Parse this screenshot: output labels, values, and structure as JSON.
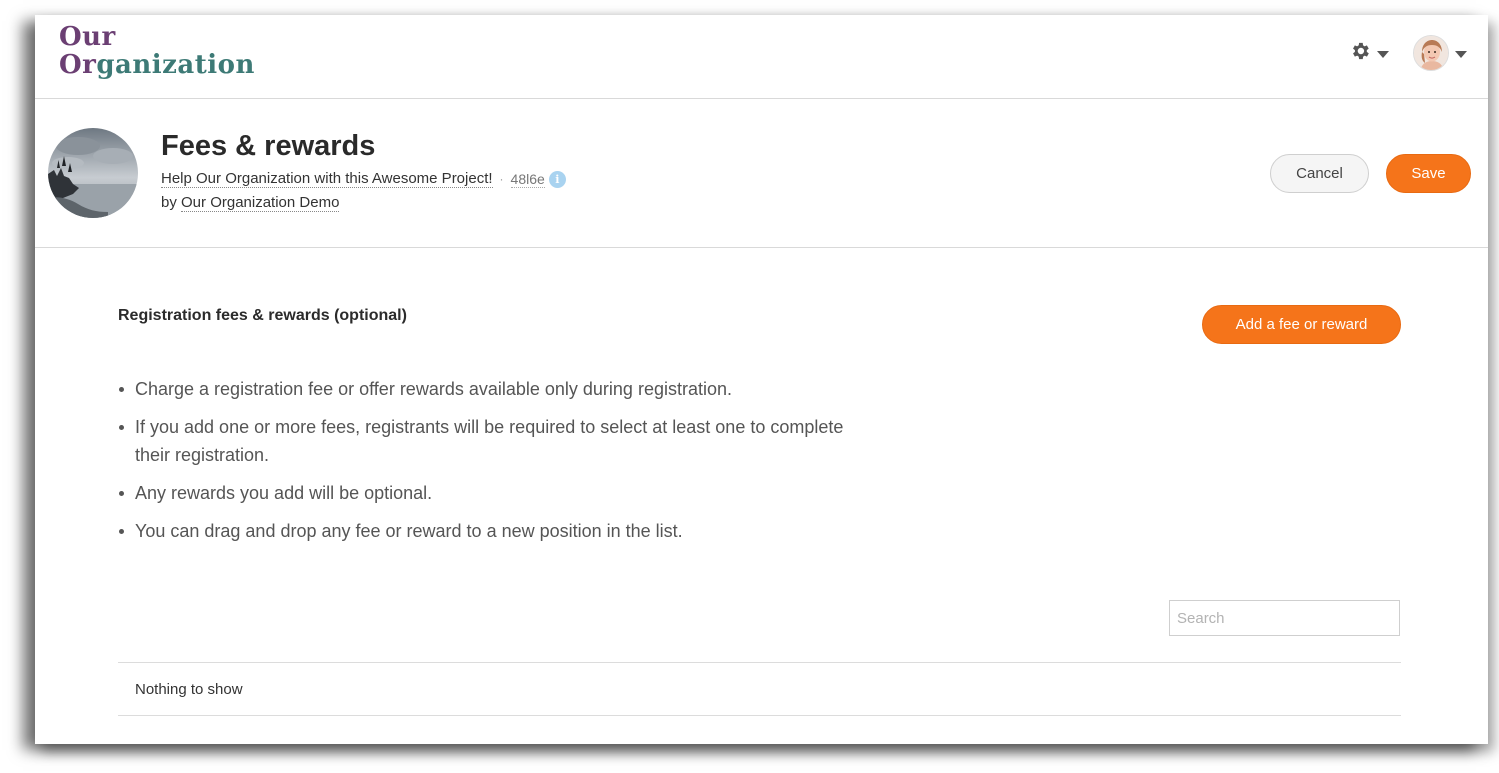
{
  "brand": {
    "line1": "Our",
    "line2_a": "Or",
    "line2_b": "ganization",
    "color_primary": "#6b3f73",
    "color_secondary": "#3d7a76"
  },
  "topbar": {
    "settings_icon": "gear-icon",
    "user_avatar_icon": "user-avatar"
  },
  "header": {
    "title": "Fees & rewards",
    "project_link": "Help Our Organization with this Awesome Project!",
    "separator": "·",
    "project_code": "48l6e",
    "info_glyph": "i",
    "by_prefix": "by ",
    "organization_link": "Our Organization Demo",
    "cancel_label": "Cancel",
    "save_label": "Save",
    "accent_color": "#f5741a"
  },
  "main": {
    "section_title": "Registration fees & rewards (optional)",
    "add_button_label": "Add a fee or reward",
    "bullets": [
      "Charge a registration fee or offer rewards available only during registration.",
      "If you add one or more fees, registrants will be required to select at least one to complete their registration.",
      "Any rewards you add will be optional.",
      "You can drag and drop any fee or reward to a new position in the list."
    ],
    "search_placeholder": "Search",
    "empty_message": "Nothing to show"
  }
}
